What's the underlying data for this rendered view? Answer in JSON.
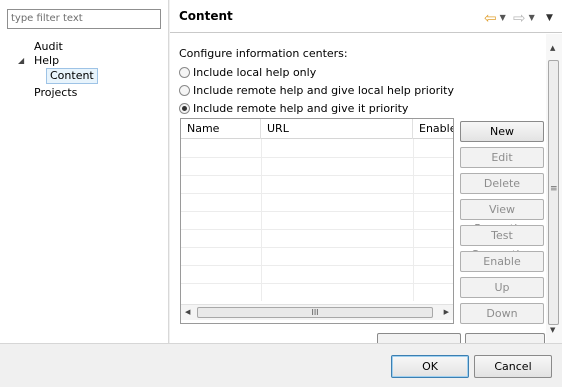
{
  "filter": {
    "placeholder": "type filter text"
  },
  "tree": {
    "items": [
      {
        "label": "Audit"
      },
      {
        "label": "Help",
        "expanded": true
      },
      {
        "label": "Content",
        "selected": true
      },
      {
        "label": "Projects"
      }
    ]
  },
  "header": {
    "title": "Content",
    "back_icon": "back-arrow-icon",
    "forward_icon": "forward-arrow-icon",
    "back_color": "#e0a030",
    "forward_color": "#b8b8b8"
  },
  "main": {
    "intro": "Configure information centers:",
    "options": [
      {
        "label": "Include local help only",
        "checked": false
      },
      {
        "label": "Include remote help and give local help priority",
        "checked": false
      },
      {
        "label": "Include remote help and give it priority",
        "checked": true
      }
    ],
    "table": {
      "columns": [
        "Name",
        "URL",
        "Enabled"
      ],
      "rows": []
    },
    "buttons": [
      {
        "label": "New",
        "enabled": true
      },
      {
        "label": "Edit",
        "enabled": false
      },
      {
        "label": "Delete",
        "enabled": false
      },
      {
        "label": "View Properties",
        "enabled": false
      },
      {
        "label": "Test Connection",
        "enabled": false
      },
      {
        "label": "Enable",
        "enabled": false
      },
      {
        "label": "Up",
        "enabled": false
      },
      {
        "label": "Down",
        "enabled": false
      }
    ],
    "scroll_grip": "≡",
    "hscroll_grip": "III"
  },
  "footer": {
    "ok_label": "OK",
    "cancel_label": "Cancel"
  }
}
